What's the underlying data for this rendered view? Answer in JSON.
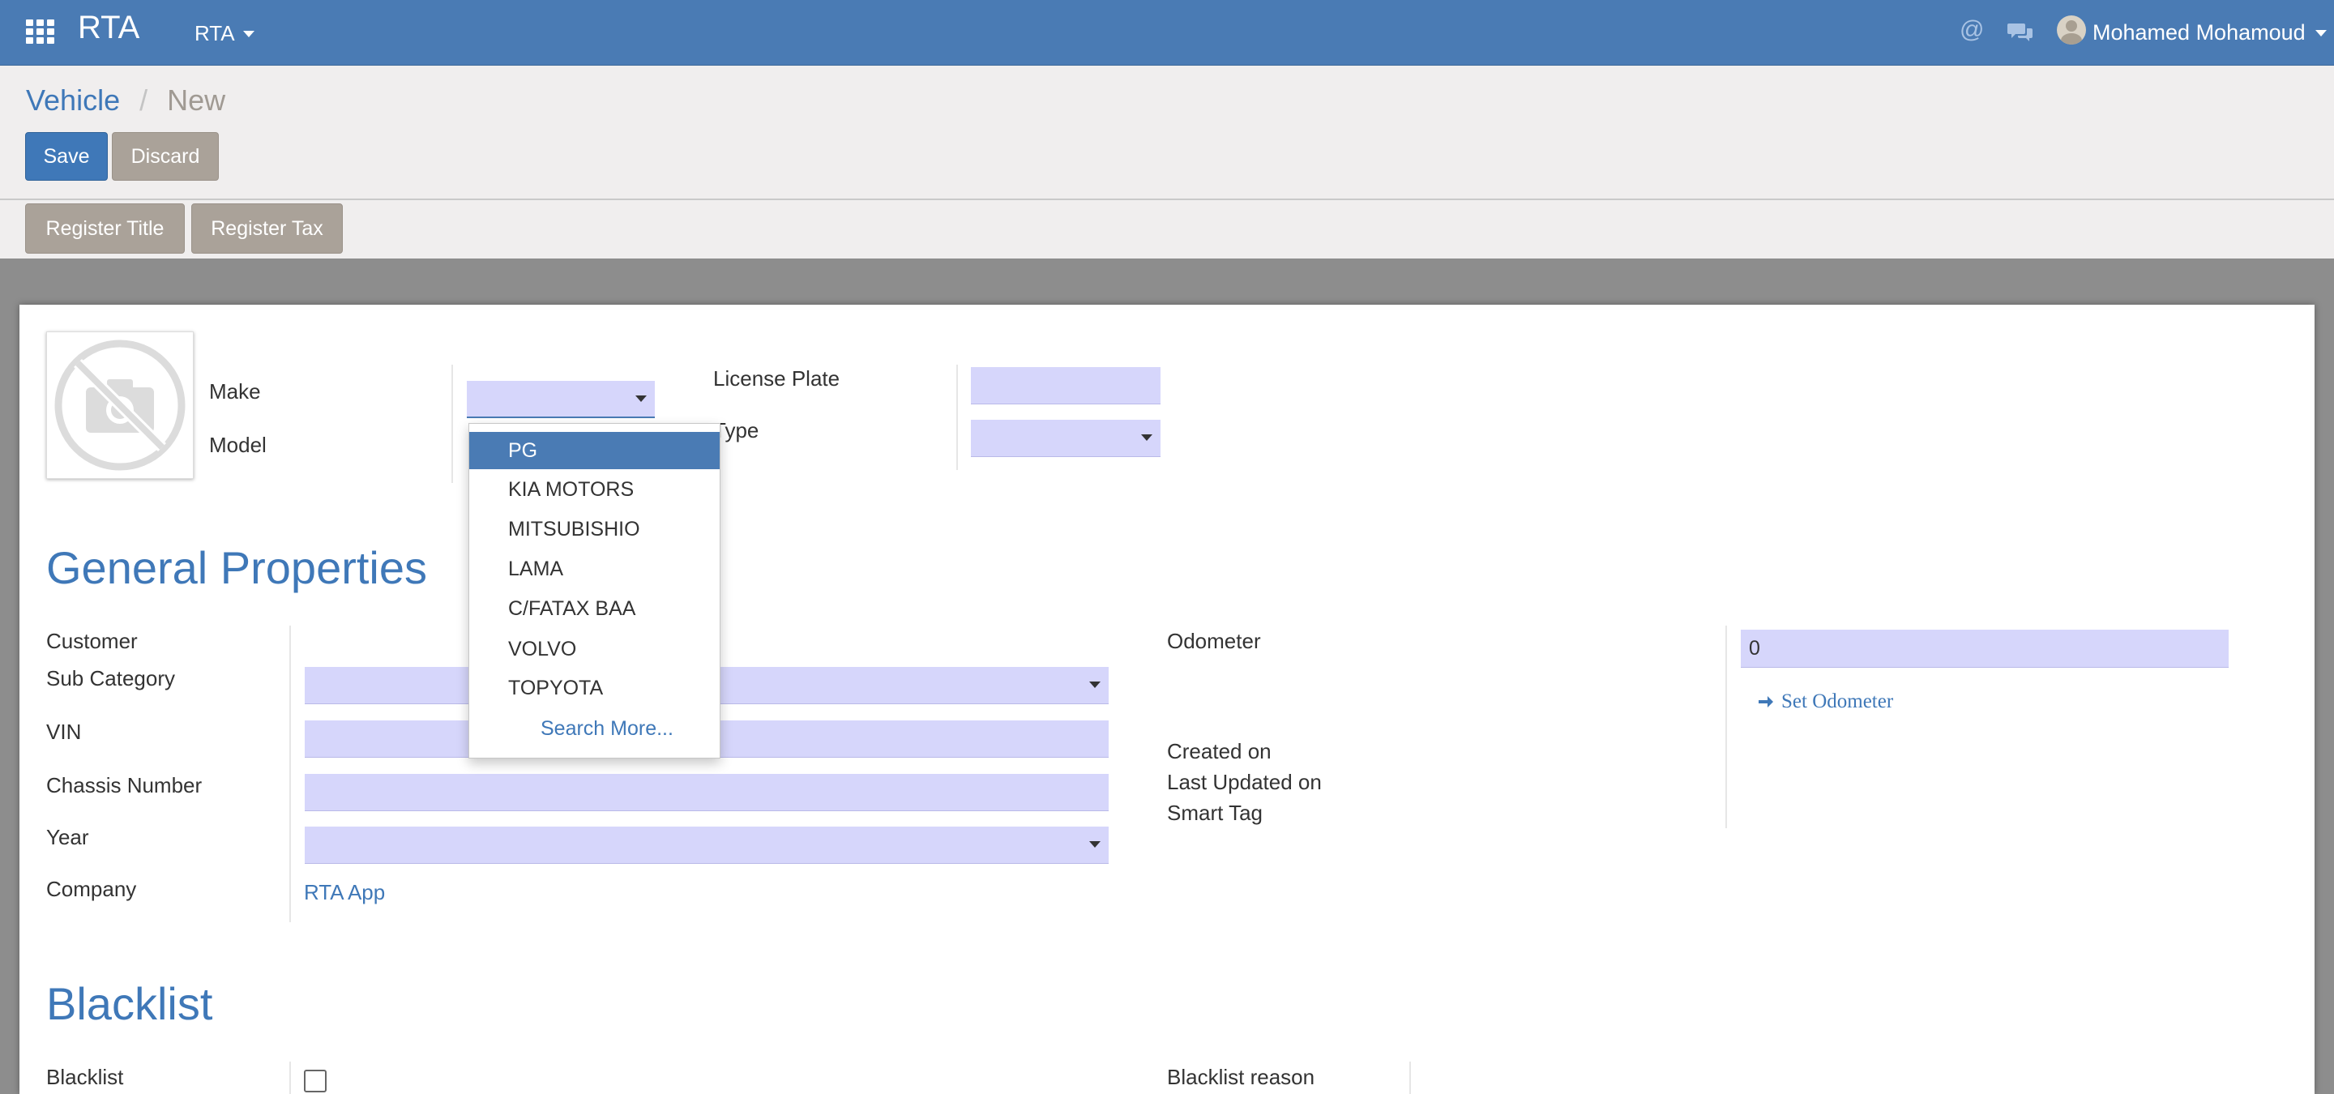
{
  "navbar": {
    "app_title": "RTA",
    "menu_label": "RTA",
    "user_name": "Mohamed Mohamoud"
  },
  "breadcrumb": {
    "parent": "Vehicle",
    "separator": "/",
    "current": "New"
  },
  "buttons": {
    "save": "Save",
    "discard": "Discard"
  },
  "header_actions": {
    "register_title": "Register Title",
    "register_tax": "Register Tax"
  },
  "top_form": {
    "make_label": "Make",
    "model_label": "Model",
    "license_plate_label": "License Plate",
    "type_label": "Type"
  },
  "make_dropdown": {
    "options": [
      "PG",
      "KIA MOTORS",
      "MITSUBISHIO",
      "LAMA",
      "C/FATAX BAA",
      "VOLVO",
      "TOPYOTA"
    ],
    "highlighted": "PG",
    "search_more": "Search More..."
  },
  "general": {
    "title": "General Properties",
    "customer_label": "Customer",
    "sub_category_label": "Sub Category",
    "vin_label": "VIN",
    "chassis_label": "Chassis Number",
    "year_label": "Year",
    "company_label": "Company",
    "company_value": "RTA App",
    "odometer_label": "Odometer",
    "odometer_value": "0",
    "set_odometer": "Set Odometer",
    "created_on_label": "Created on",
    "last_updated_label": "Last Updated on",
    "smart_tag_label": "Smart Tag"
  },
  "blacklist": {
    "title": "Blacklist",
    "blacklist_label": "Blacklist",
    "reason_label": "Blacklist reason"
  },
  "colors": {
    "navbar": "#4a7bb4",
    "primary": "#3f78b8",
    "secondary_button": "#aaa299",
    "input_bg": "#d6d6fb",
    "control_panel": "#f0eeee"
  }
}
